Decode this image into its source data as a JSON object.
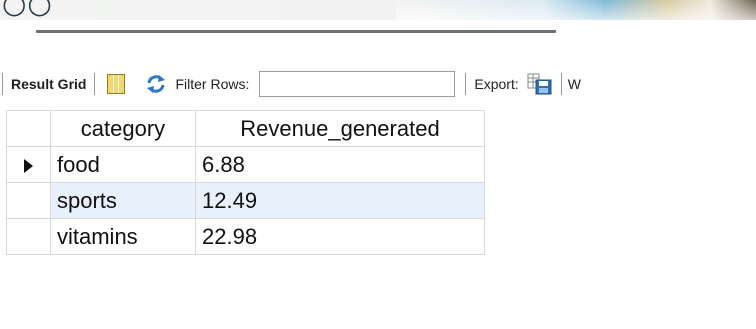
{
  "toolbar": {
    "result_grid_label": "Result Grid",
    "grid_icon": "grid-icon",
    "refresh_icon": "refresh-arrows-icon",
    "filter_label": "Filter Rows:",
    "filter_value": "",
    "export_label": "Export:",
    "export_icon": "export-save-icon",
    "cut_label": "W"
  },
  "grid": {
    "columns": [
      "category",
      "Revenue_generated"
    ],
    "rows": [
      {
        "category": "food",
        "revenue": "6.88"
      },
      {
        "category": "sports",
        "revenue": "12.49"
      },
      {
        "category": "vitamins",
        "revenue": "22.98"
      }
    ]
  },
  "colors": {
    "selected_row_bg": "#e8f1fb",
    "grid_border": "#d9d9d9"
  }
}
